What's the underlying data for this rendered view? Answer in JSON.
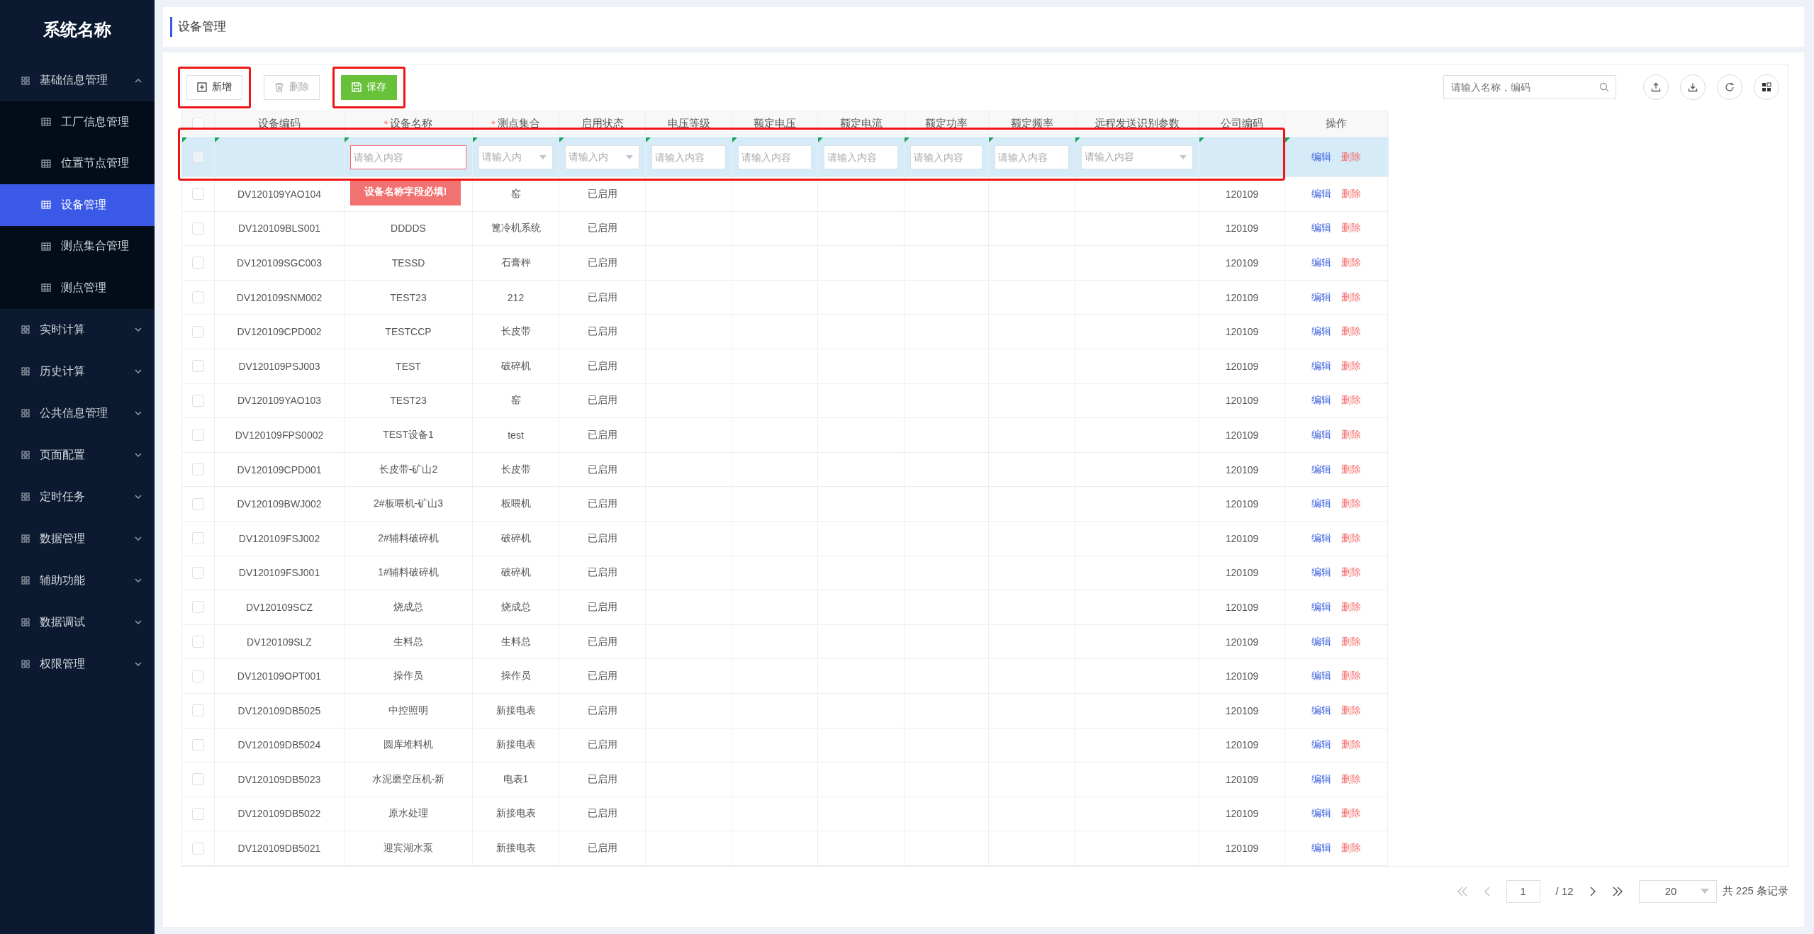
{
  "sidebar": {
    "title": "系统名称",
    "items": [
      {
        "label": "基础信息管理",
        "expanded": true,
        "children": [
          {
            "label": "工厂信息管理",
            "selected": false
          },
          {
            "label": "位置节点管理",
            "selected": false
          },
          {
            "label": "设备管理",
            "selected": true
          },
          {
            "label": "测点集合管理",
            "selected": false
          },
          {
            "label": "测点管理",
            "selected": false
          }
        ]
      },
      {
        "label": "实时计算",
        "expanded": false
      },
      {
        "label": "历史计算",
        "expanded": false
      },
      {
        "label": "公共信息管理",
        "expanded": false
      },
      {
        "label": "页面配置",
        "expanded": false
      },
      {
        "label": "定时任务",
        "expanded": false
      },
      {
        "label": "数据管理",
        "expanded": false
      },
      {
        "label": "辅助功能",
        "expanded": false
      },
      {
        "label": "数据调试",
        "expanded": false
      },
      {
        "label": "权限管理",
        "expanded": false
      }
    ]
  },
  "page_title": "设备管理",
  "toolbar": {
    "buttons": [
      {
        "label": "新增",
        "kind": "add",
        "highlighted": true
      },
      {
        "label": "删除",
        "kind": "delete",
        "highlighted": false
      },
      {
        "label": "保存",
        "kind": "save",
        "highlighted": true
      }
    ],
    "search": {
      "placeholder": "请输入名称，编码"
    },
    "icon_buttons": [
      {
        "kind": "upload"
      },
      {
        "kind": "download"
      },
      {
        "kind": "refresh"
      },
      {
        "kind": "grid"
      }
    ]
  },
  "table": {
    "select_all": {
      "checked": false
    },
    "columns": [
      {
        "label": "设备编码"
      },
      {
        "label": "设备名称",
        "required_mark": "*"
      },
      {
        "label": "测点集合",
        "required_mark": "*"
      },
      {
        "label": "启用状态"
      },
      {
        "label": "电压等级"
      },
      {
        "label": "额定电压"
      },
      {
        "label": "额定电流"
      },
      {
        "label": "额定功率"
      },
      {
        "label": "额定频率"
      },
      {
        "label": "远程发送识别参数"
      },
      {
        "label": "公司编码"
      },
      {
        "label": "操作"
      }
    ],
    "new_row": {
      "highlighted": true,
      "dirty": true,
      "checked": false,
      "cells": [
        {
          "kind": "empty"
        },
        {
          "kind": "input",
          "placeholder": "请输入内容",
          "error": true,
          "error_message": "设备名称字段必填!"
        },
        {
          "kind": "select",
          "placeholder": "请输入内"
        },
        {
          "kind": "select",
          "placeholder": "请输入内"
        },
        {
          "kind": "input",
          "placeholder": "请输入内容",
          "error": false
        },
        {
          "kind": "input",
          "placeholder": "请输入内容",
          "error": false
        },
        {
          "kind": "input",
          "placeholder": "请输入内容",
          "error": false
        },
        {
          "kind": "input",
          "placeholder": "请输入内容",
          "error": false
        },
        {
          "kind": "input",
          "placeholder": "请输入内容",
          "error": false
        },
        {
          "kind": "select",
          "placeholder": "请输入内容"
        },
        {
          "kind": "empty"
        }
      ],
      "actions": [
        "编辑",
        "删除"
      ]
    },
    "rows": [
      {
        "checked": false,
        "code": "DV120109YAO104",
        "set": "窑",
        "status": "已启用",
        "company": "120109",
        "actions": [
          "编辑",
          "删除"
        ]
      },
      {
        "checked": false,
        "code": "DV120109BLS001",
        "name": "DDDDS",
        "set": "篦冷机系统",
        "status": "已启用",
        "company": "120109",
        "actions": [
          "编辑",
          "删除"
        ]
      },
      {
        "checked": false,
        "code": "DV120109SGC003",
        "name": "TESSD",
        "set": "石膏秤",
        "status": "已启用",
        "company": "120109",
        "actions": [
          "编辑",
          "删除"
        ]
      },
      {
        "checked": false,
        "code": "DV120109SNM002",
        "name": "TEST23",
        "set": "212",
        "status": "已启用",
        "company": "120109",
        "actions": [
          "编辑",
          "删除"
        ]
      },
      {
        "checked": false,
        "code": "DV120109CPD002",
        "name": "TESTCCP",
        "set": "长皮带",
        "status": "已启用",
        "company": "120109",
        "actions": [
          "编辑",
          "删除"
        ]
      },
      {
        "checked": false,
        "code": "DV120109PSJ003",
        "name": "TEST",
        "set": "破碎机",
        "status": "已启用",
        "company": "120109",
        "actions": [
          "编辑",
          "删除"
        ]
      },
      {
        "checked": false,
        "code": "DV120109YAO103",
        "name": "TEST23",
        "set": "窑",
        "status": "已启用",
        "company": "120109",
        "actions": [
          "编辑",
          "删除"
        ]
      },
      {
        "checked": false,
        "code": "DV120109FPS0002",
        "name": "TEST设备1",
        "set": "test",
        "status": "已启用",
        "company": "120109",
        "actions": [
          "编辑",
          "删除"
        ]
      },
      {
        "checked": false,
        "code": "DV120109CPD001",
        "name": "长皮带-矿山2",
        "set": "长皮带",
        "status": "已启用",
        "company": "120109",
        "actions": [
          "编辑",
          "删除"
        ]
      },
      {
        "checked": false,
        "code": "DV120109BWJ002",
        "name": "2#板喂机-矿山3",
        "set": "板喂机",
        "status": "已启用",
        "company": "120109",
        "actions": [
          "编辑",
          "删除"
        ]
      },
      {
        "checked": false,
        "code": "DV120109FSJ002",
        "name": "2#辅料破碎机",
        "set": "破碎机",
        "status": "已启用",
        "company": "120109",
        "actions": [
          "编辑",
          "删除"
        ]
      },
      {
        "checked": false,
        "code": "DV120109FSJ001",
        "name": "1#辅料破碎机",
        "set": "破碎机",
        "status": "已启用",
        "company": "120109",
        "actions": [
          "编辑",
          "删除"
        ]
      },
      {
        "checked": false,
        "code": "DV120109SCZ",
        "name": "烧成总",
        "set": "烧成总",
        "status": "已启用",
        "company": "120109",
        "actions": [
          "编辑",
          "删除"
        ]
      },
      {
        "checked": false,
        "code": "DV120109SLZ",
        "name": "生料总",
        "set": "生料总",
        "status": "已启用",
        "company": "120109",
        "actions": [
          "编辑",
          "删除"
        ]
      },
      {
        "checked": false,
        "code": "DV120109OPT001",
        "name": "操作员",
        "set": "操作员",
        "status": "已启用",
        "company": "120109",
        "actions": [
          "编辑",
          "删除"
        ]
      },
      {
        "checked": false,
        "code": "DV120109DB5025",
        "name": "中控照明",
        "set": "新接电表",
        "status": "已启用",
        "company": "120109",
        "actions": [
          "编辑",
          "删除"
        ]
      },
      {
        "checked": false,
        "code": "DV120109DB5024",
        "name": "圆库堆料机",
        "set": "新接电表",
        "status": "已启用",
        "company": "120109",
        "actions": [
          "编辑",
          "删除"
        ]
      },
      {
        "checked": false,
        "code": "DV120109DB5023",
        "name": "水泥磨空压机-新",
        "set": "电表1",
        "status": "已启用",
        "company": "120109",
        "actions": [
          "编辑",
          "删除"
        ]
      },
      {
        "checked": false,
        "code": "DV120109DB5022",
        "name": "原水处理",
        "set": "新接电表",
        "status": "已启用",
        "company": "120109",
        "actions": [
          "编辑",
          "删除"
        ]
      },
      {
        "checked": false,
        "code": "DV120109DB5021",
        "name": "迎宾湖水泵",
        "set": "新接电表",
        "status": "已启用",
        "company": "120109",
        "actions": [
          "编辑",
          "删除"
        ]
      }
    ]
  },
  "pagination": {
    "first_disabled": true,
    "prev_disabled": true,
    "page": "1",
    "total_pages": "/ 12",
    "page_size": "20",
    "total": "共 225 条记录"
  }
}
